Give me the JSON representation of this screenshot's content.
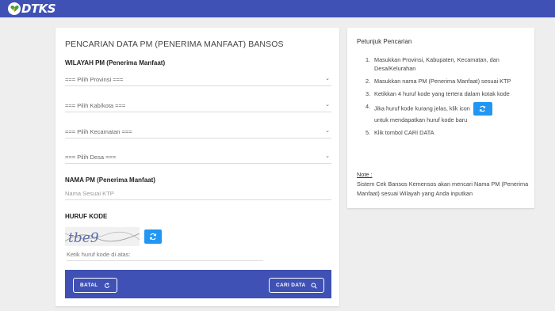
{
  "app": {
    "logo_text": "DTKS"
  },
  "colors": {
    "primary": "#3f51b5",
    "accent_button": "#2196f3"
  },
  "form": {
    "title": "PENCARIAN DATA PM (PENERIMA MANFAAT) BANSOS",
    "wilayah_label": "WILAYAH PM (Penerima Manfaat)",
    "selects": {
      "provinsi": "=== Pilih Provinsi ===",
      "kabkota": "=== Pilih Kab/kota ===",
      "kecamatan": "=== Pilih Kecamatan ===",
      "desa": "=== Pilih Desa ==="
    },
    "nama_label": "NAMA PM (Penerima Manfaat)",
    "nama_placeholder": "Nama Sesuai KTP",
    "kode_label": "HURUF KODE",
    "captcha_text": "tbe9",
    "kode_placeholder": "Ketik huruf kode di atas:",
    "batal_label": "BATAL",
    "cari_label": "CARI DATA",
    "icons": {
      "refresh": "refresh-icon",
      "search": "search-icon",
      "chevron": "chevron-down-icon"
    }
  },
  "petunjuk": {
    "title": "Petunjuk Pencarian",
    "steps": [
      "Masukkan Provinsi, Kabupaten, Kecamatan, dan Desa/Kelurahan",
      "Masukkan nama PM (Penerima Manfaat) sesuai KTP",
      "Ketikkan 4 huruf kode yang tertera dalam kotak kode",
      "Jika huruf kode kurang jelas, klik icon",
      "Klik tombol CARI DATA"
    ],
    "step4_suffix": "untuk mendapatkan huruf kode baru",
    "note_head": "Note :",
    "note_text": "Sistem Cek Bansos Kemensos akan mencari Nama PM (Penerima Manfaat) sesuai Wilayah yang Anda inputkan"
  }
}
